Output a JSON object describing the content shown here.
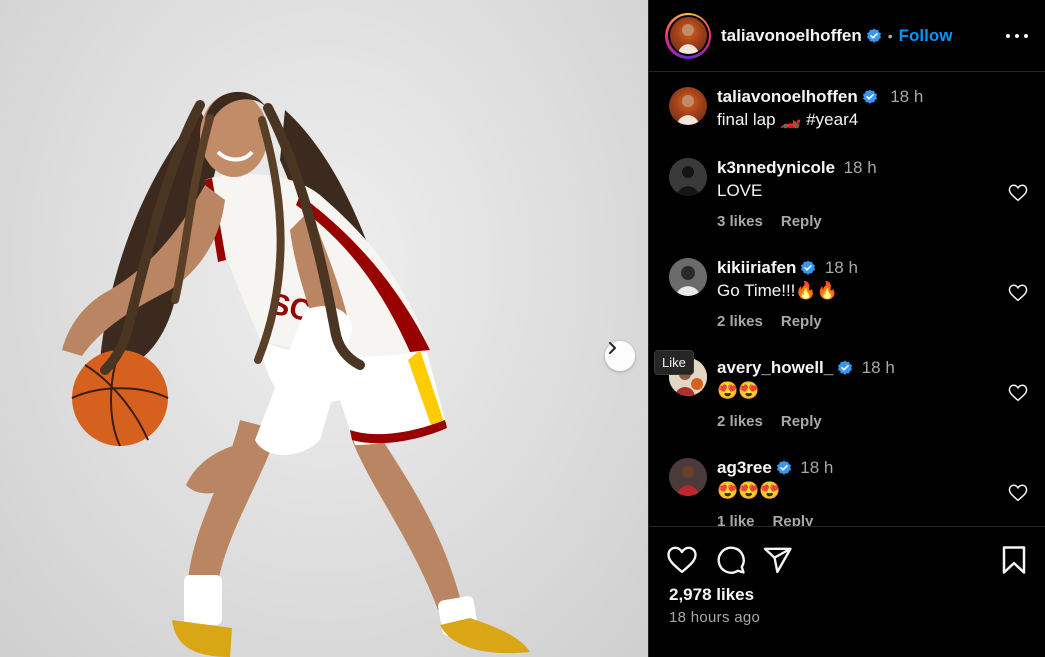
{
  "post": {
    "author": "taliavonoelhoffen",
    "follow_label": "Follow",
    "separator": "•",
    "caption_author": "taliavonoelhoffen",
    "caption_time": "18 h",
    "caption_text": "final lap 🏎️ #year4",
    "likes": "2,978 likes",
    "posted": "18 hours ago"
  },
  "comments": [
    {
      "user": "k3nnedynicole",
      "verified": false,
      "time": "18 h",
      "text": "LOVE",
      "likes": "3 likes",
      "reply": "Reply"
    },
    {
      "user": "kikiiriafen",
      "verified": true,
      "time": "18 h",
      "text": "Go Time!!!🔥🔥",
      "likes": "2 likes",
      "reply": "Reply"
    },
    {
      "user": "avery_howell_",
      "verified": true,
      "time": "18 h",
      "text": "😍😍",
      "likes": "2 likes",
      "reply": "Reply"
    },
    {
      "user": "ag3ree",
      "verified": true,
      "time": "18 h",
      "text": "😍😍😍",
      "likes": "1 like",
      "reply": "Reply"
    }
  ],
  "tooltip": "Like",
  "icons": {
    "more": "more-options-icon",
    "next": "chevron-right-icon",
    "like": "heart-icon",
    "comment": "comment-icon",
    "share": "share-icon",
    "save": "bookmark-icon",
    "verified": "verified-badge-icon"
  },
  "colors": {
    "background": "#000000",
    "link": "#0095f6",
    "verified": "#3897f0",
    "muted": "#a8a8a8",
    "jersey_cardinal": "#990000",
    "jersey_gold": "#ffcc00"
  }
}
